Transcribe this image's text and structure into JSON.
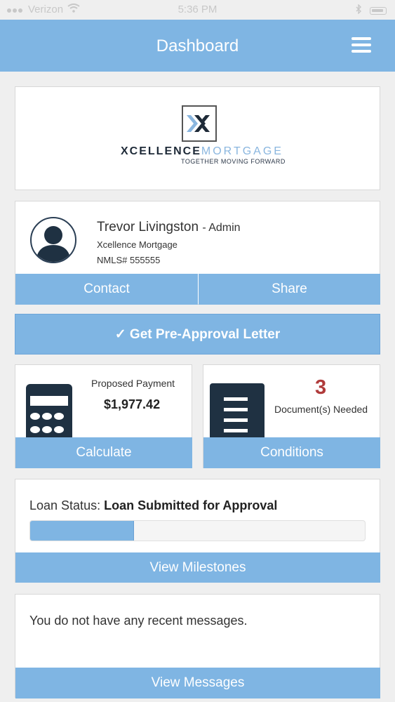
{
  "status_bar": {
    "carrier": "Verizon",
    "time": "5:36 PM"
  },
  "header": {
    "title": "Dashboard"
  },
  "logo": {
    "name_part1": "XCELLENCE",
    "name_part2": "MORTGAGE",
    "tagline": "TOGETHER MOVING FORWARD"
  },
  "profile": {
    "name": "Trevor Livingston",
    "role": "- Admin",
    "company": "Xcellence Mortgage",
    "nmls": "NMLS# 555555",
    "contact_label": "Contact",
    "share_label": "Share"
  },
  "preapproval": {
    "label": "✓ Get Pre-Approval Letter"
  },
  "payment": {
    "label": "Proposed Payment",
    "value": "$1,977.42",
    "button_label": "Calculate"
  },
  "conditions": {
    "count": "3",
    "label": "Document(s) Needed",
    "button_label": "Conditions"
  },
  "loan_status": {
    "prefix": "Loan Status:",
    "status": "Loan Submitted for Approval",
    "progress_fraction": 0.31,
    "button_label": "View Milestones"
  },
  "messages": {
    "text": "You do not have any recent messages.",
    "button_label": "View Messages"
  },
  "colors": {
    "accent": "#7fb5e3",
    "header_text": "#ffffff",
    "dark_icon": "#1f3142",
    "alert": "#b03b3b"
  }
}
